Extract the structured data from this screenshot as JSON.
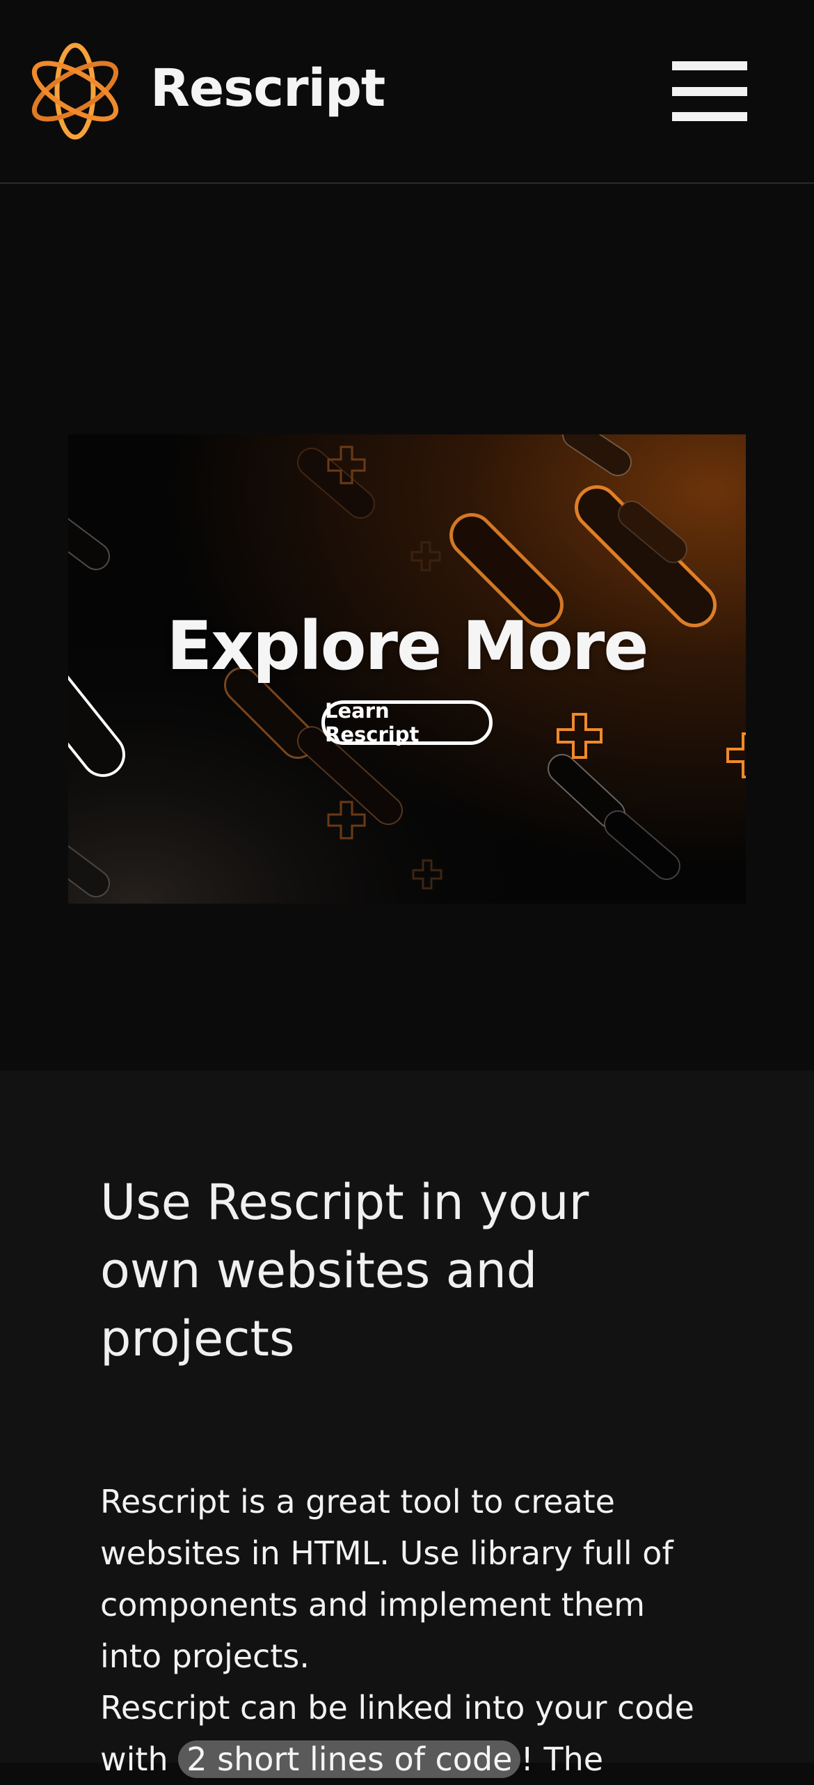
{
  "header": {
    "brand": "Rescript",
    "logo_icon": "atom-orbit-icon",
    "menu_icon": "hamburger-menu-icon"
  },
  "hero": {
    "title": "Explore More",
    "button_label": "Learn Rescript"
  },
  "intro": {
    "heading": "Use Rescript in your own websites and projects",
    "paragraph1": "Rescript is a great tool to create websites in HTML. Use library full of components and implement them into projects.",
    "paragraph2_start": "Rescript can be linked into your code with ",
    "code_highlight": "2 short lines of code",
    "paragraph2_end": "! The"
  },
  "colors": {
    "background": "#0b0b0b",
    "section_background": "#121212",
    "accent": "#f08a2c",
    "text": "#f2f2f2",
    "highlight_background": "#5a5a5a"
  }
}
